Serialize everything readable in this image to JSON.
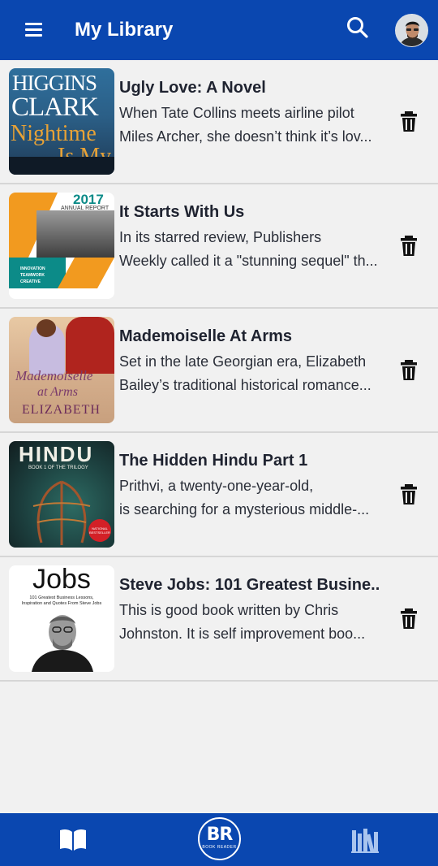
{
  "header": {
    "title": "My Library",
    "menu_icon": "menu-icon",
    "search_icon": "search-icon",
    "avatar": "profile-avatar"
  },
  "books": [
    {
      "title": "Ugly Love: A Novel",
      "desc_line1": "When Tate Collins meets airline pilot",
      "desc_line2": "Miles Archer, she doesn’t think it’s lov...",
      "cover_text": [
        "HIGGINS",
        "CLARK",
        "Nightime",
        "Is My"
      ]
    },
    {
      "title": "It Starts With Us",
      "desc_line1": "In its starred review, Publishers",
      "desc_line2": "Weekly called it a \"stunning sequel\" th...",
      "cover_text": [
        "2017",
        "ANNUAL REPORT",
        "INNOVATION",
        "TEAMWORK",
        "CREATIVE"
      ]
    },
    {
      "title": "Mademoiselle At Arms",
      "desc_line1": "Set in the late Georgian era, Elizabeth",
      "desc_line2": "Bailey’s traditional historical romance...",
      "cover_text": [
        "Mademoiselle",
        "at Arms",
        "ELIZABETH"
      ]
    },
    {
      "title": "The Hidden Hindu Part 1",
      "desc_line1": "Prithvi, a twenty-one-year-old,",
      "desc_line2": "is searching for a mysterious middle-...",
      "cover_text": [
        "HINDU",
        "BOOK 1 OF THE TRILOGY",
        "NATIONAL BESTSELLER"
      ]
    },
    {
      "title": "Steve Jobs: 101 Greatest Busine..",
      "desc_line1": "This is good book written by Chris",
      "desc_line2": "Johnston. It is self improvement boo...",
      "cover_text": [
        "Jobs",
        "101 Greatest Business Lessons,",
        "Inspiration and Quotes From Steve Jobs"
      ]
    }
  ],
  "bottom_nav": {
    "read_icon": "open-book-icon",
    "logo_text": "BR",
    "logo_sub": "BOOK READER",
    "library_icon": "library-shelf-icon"
  },
  "colors": {
    "primary": "#0a47b0",
    "background": "#f1f1f1",
    "divider": "#d6d6d6"
  }
}
